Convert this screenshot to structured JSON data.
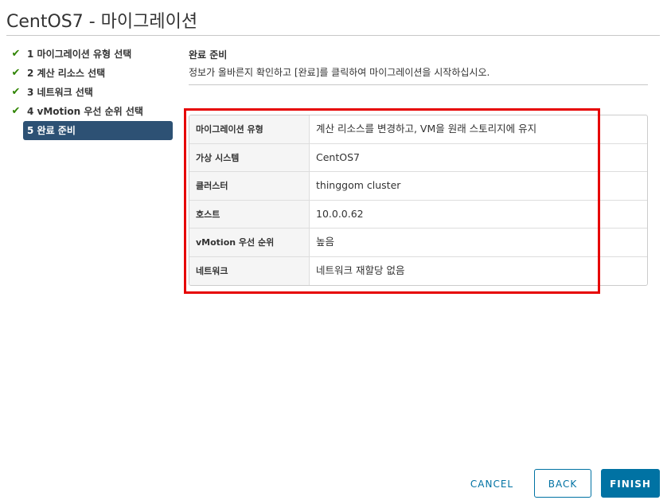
{
  "dialog": {
    "title": "CentOS7 - 마이그레이션"
  },
  "steps": [
    {
      "label": "1 마이그레이션 유형 선택",
      "completed": true,
      "icon": "check-icon"
    },
    {
      "label": "2 계산 리소스 선택",
      "completed": true,
      "icon": "check-icon"
    },
    {
      "label": "3 네트워크 선택",
      "completed": true,
      "icon": "check-icon"
    },
    {
      "label": "4 vMotion 우선 순위 선택",
      "completed": true,
      "icon": "check-icon"
    },
    {
      "label": "5 완료 준비",
      "completed": false,
      "active": true
    }
  ],
  "main": {
    "section_title": "완료 준비",
    "section_desc": "정보가 올바른지 확인하고 [완료]를 클릭하여 마이그레이션을 시작하십시오.",
    "summary": [
      {
        "key": "마이그레이션 유형",
        "value": "계산 리소스를 변경하고, VM을 원래 스토리지에 유지"
      },
      {
        "key": "가상 시스템",
        "value": "CentOS7"
      },
      {
        "key": "클러스터",
        "value": "thinggom cluster"
      },
      {
        "key": "호스트",
        "value": "10.0.0.62"
      },
      {
        "key": "vMotion 우선 순위",
        "value": "높음"
      },
      {
        "key": "네트워크",
        "value": "네트워크 재할당 없음"
      }
    ]
  },
  "footer": {
    "cancel_label": "CANCEL",
    "back_label": "BACK",
    "finish_label": "FINISH"
  },
  "colors": {
    "check": "#2f8400",
    "active_step_bg": "#2d5174",
    "primary": "#0072a3",
    "highlight_box": "#e60000"
  }
}
